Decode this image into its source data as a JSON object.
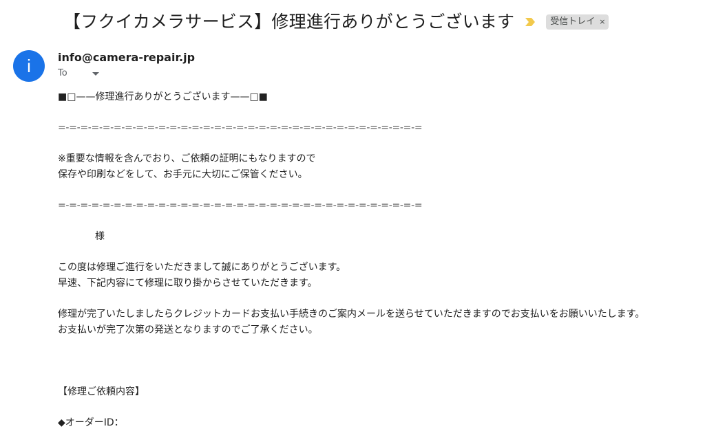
{
  "header": {
    "subject": "【フクイカメラサービス】修理進行ありがとうございます",
    "label": "受信トレイ",
    "label_remove": "×",
    "importance_icon": "importance-marker-icon",
    "importance_color": "#f2c94c"
  },
  "sender": {
    "avatar_letter": "i",
    "avatar_color": "#1a73e8",
    "email": "info@camera-repair.jp",
    "to_label": "To"
  },
  "body": {
    "title_line": "■□——修理進行ありがとうございます——□■",
    "separator": "=-=-=-=-=-=-=-=-=-=-=-=-=-=-=-=-=-=-=-=-=-=-=-=-=-=-=-=-=-=-=-=-=",
    "notice_1": "※重要な情報を含んでおり、ご依頼の証明にもなりますので",
    "notice_2": "保存や印刷などをして、お手元に大切にご保管ください。",
    "honorific": "様",
    "thanks_1": "この度は修理ご進行をいただきまして誠にありがとうございます。",
    "thanks_2": "早速、下記内容にて修理に取り掛からさせていただきます。",
    "payment_1": "修理が完了いたしましたらクレジットカードお支払い手続きのご案内メールを送らせていただきますのでお支払いをお願いいたします。",
    "payment_2": "お支払いが完了次第の発送となりますのでご了承ください。",
    "request_heading": "【修理ご依頼内容】",
    "order_id_label": "◆オーダーID："
  }
}
